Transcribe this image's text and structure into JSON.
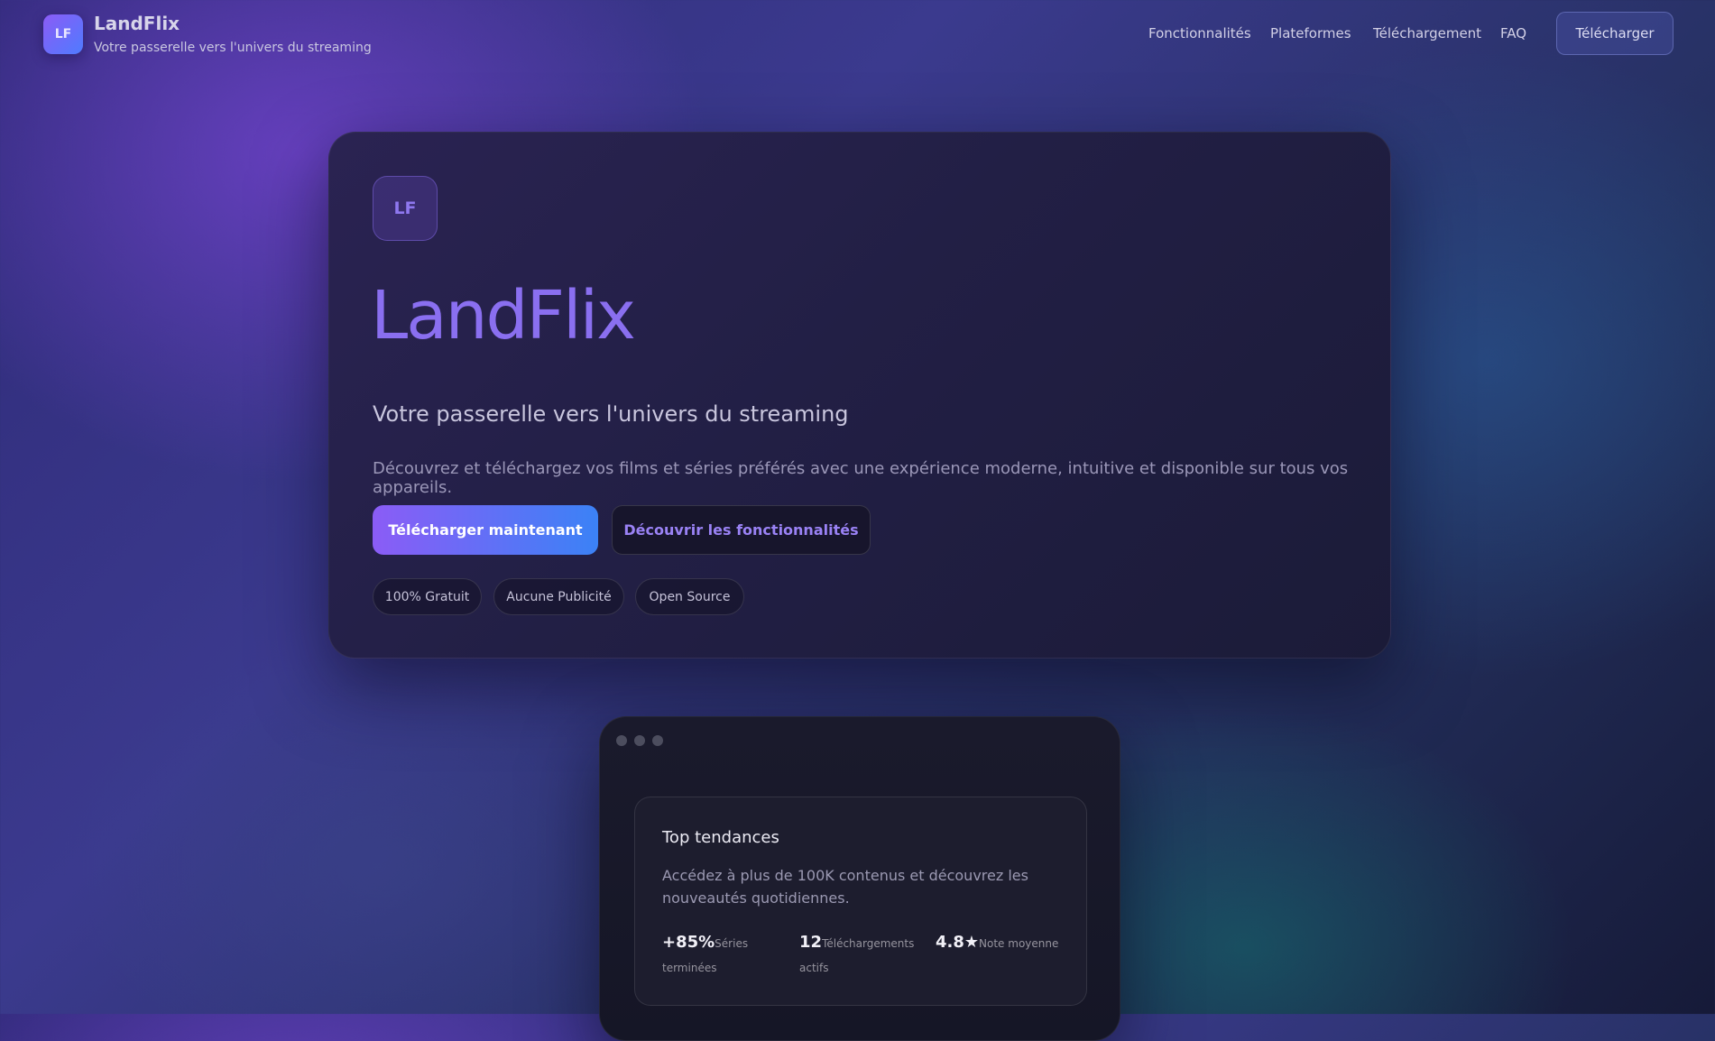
{
  "header": {
    "brand_badge": "LF",
    "brand_name": "LandFlix",
    "brand_tagline": "Votre passerelle vers l'univers du streaming",
    "nav": [
      {
        "label": "Fonctionnalités"
      },
      {
        "label": "Plateformes"
      },
      {
        "label": "Téléchargement"
      },
      {
        "label": "FAQ"
      }
    ],
    "cta_label": "Télécharger"
  },
  "hero": {
    "badge": "LF",
    "title": "LandFlix",
    "subtitle": "Votre passerelle vers l'univers du streaming",
    "description": "Découvrez et téléchargez vos films et séries préférés avec une expérience moderne, intuitive et disponible sur tous vos appareils.",
    "primary_button": "Télécharger maintenant",
    "secondary_button": "Découvrir les fonctionnalités",
    "pills": [
      {
        "label": "100% Gratuit"
      },
      {
        "label": "Aucune Publicité"
      },
      {
        "label": "Open Source"
      }
    ]
  },
  "preview": {
    "card_title": "Top tendances",
    "card_description": "Accédez à plus de 100K contenus et découvrez les nouveautés quotidiennes.",
    "stats": [
      {
        "value": "+85%",
        "label": "Séries terminées"
      },
      {
        "value": "12",
        "label": "Téléchargements actifs"
      },
      {
        "value": "4.8★",
        "label": "Note moyenne"
      }
    ]
  },
  "colors": {
    "accent_purple": "#8b5cf6",
    "accent_blue": "#3b82f6",
    "title_purple": "#8a6ff0"
  }
}
